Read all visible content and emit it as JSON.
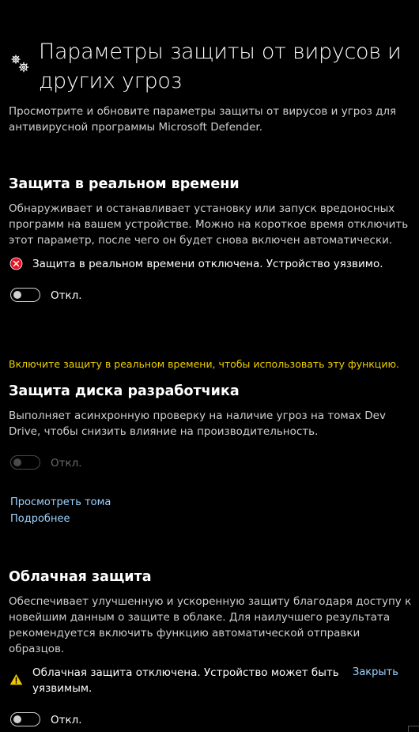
{
  "header": {
    "title": "Параметры защиты от вирусов и других угроз",
    "description": "Просмотрите и обновите параметры защиты от вирусов и угроз для антивирусной программы Microsoft Defender."
  },
  "realtime": {
    "title": "Защита в реальном времени",
    "description": "Обнаруживает и останавливает установку или запуск вредоносных программ на вашем устройстве. Можно на короткое время отключить этот параметр, после чего он будет снова включен автоматически.",
    "status": "Защита в реальном времени отключена. Устройство уязвимо.",
    "toggle_label": "Откл.",
    "toggle_on": false
  },
  "devdrive": {
    "notice": "Включите защиту в реальном времени, чтобы использовать эту функцию.",
    "title": "Защита диска разработчика",
    "description": "Выполняет асинхронную проверку на наличие угроз на томах Dev Drive, чтобы снизить влияние на производительность.",
    "toggle_label": "Откл.",
    "toggle_on": false,
    "link_volumes": "Просмотреть тома",
    "link_more": "Подробнее"
  },
  "cloud": {
    "title": "Облачная защита",
    "description": "Обеспечивает улучшенную и ускоренную защиту благодаря доступу к новейшим данным о защите в облаке. Для наилучшего результата рекомендуется включить функцию автоматической отправки образцов.",
    "status": "Облачная защита отключена. Устройство может быть уязвимым.",
    "close_label": "Закрыть",
    "toggle_label": "Откл.",
    "toggle_on": false
  },
  "icons": {
    "title": "gears-icon",
    "error": "error-circle-icon",
    "warning": "warning-triangle-icon"
  },
  "colors": {
    "background": "#000000",
    "error": "#e81123",
    "warning": "#f0c800",
    "link": "#9fd3ff",
    "notice": "#f0d000"
  }
}
